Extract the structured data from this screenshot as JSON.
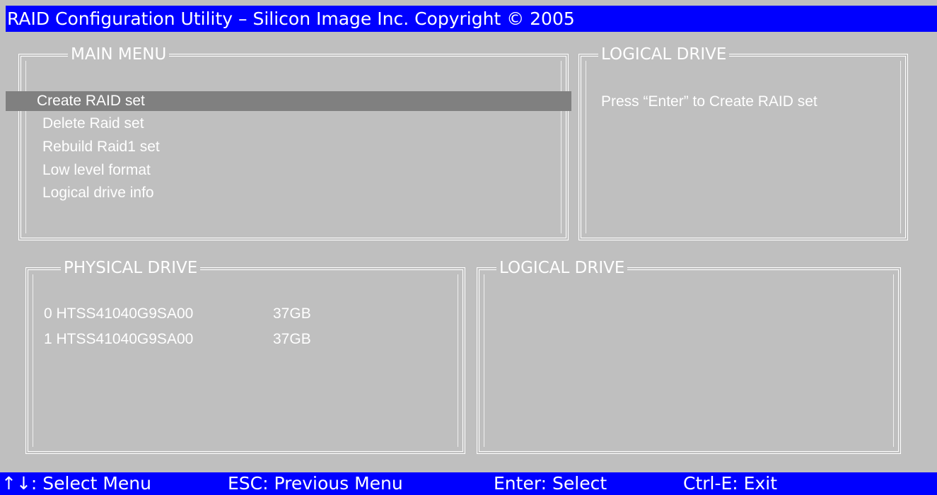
{
  "title_bar": {
    "text": "RAID Configuration Utility – Silicon Image Inc. Copyright © 2005"
  },
  "main_menu": {
    "title": "MAIN MENU",
    "selected_index": 0,
    "items": [
      {
        "label": "Create RAID set"
      },
      {
        "label": "Delete Raid set"
      },
      {
        "label": "Rebuild Raid1 set"
      },
      {
        "label": "Low level format"
      },
      {
        "label": "Logical drive info"
      }
    ]
  },
  "logical_drive_help": {
    "title": "LOGICAL DRIVE",
    "text": "Press “Enter” to Create RAID set"
  },
  "physical_drive": {
    "title": "PHYSICAL DRIVE",
    "drives": [
      {
        "id": "0",
        "model": "HTSS41040G9SA00",
        "size": "37GB"
      },
      {
        "id": "1",
        "model": "HTSS41040G9SA00",
        "size": "37GB"
      }
    ]
  },
  "logical_drive": {
    "title": "LOGICAL DRIVE"
  },
  "status_bar": {
    "select_menu": "↑↓: Select Menu",
    "previous_menu": "ESC: Previous Menu",
    "select": "Enter: Select",
    "exit": "Ctrl-E: Exit"
  },
  "colors": {
    "bar_background": "#0000ff",
    "screen_background": "#bfbfbf",
    "highlight": "#808080",
    "text": "#ffffff"
  }
}
